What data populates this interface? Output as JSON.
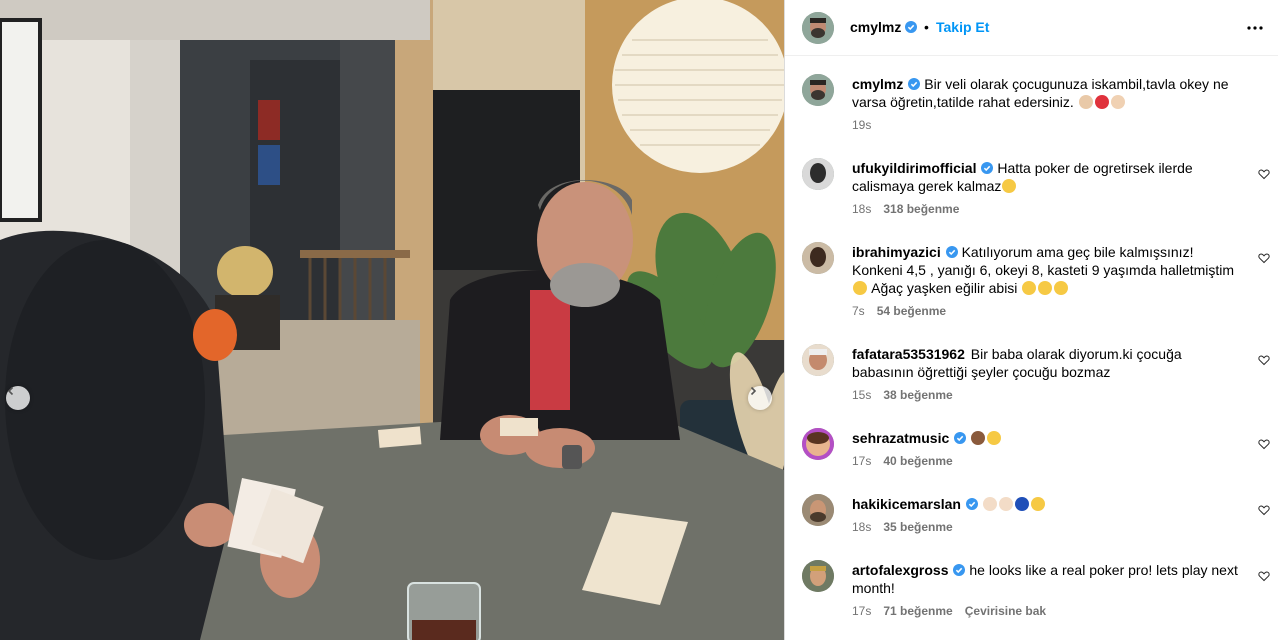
{
  "post": {
    "author": "cmylmz",
    "follow_label": "Takip Et",
    "separator": "•",
    "caption": "Bir veli olarak çocugunuza iskambil,tavla okey ne varsa öğretin,tatilde rahat edersiniz.",
    "caption_time": "19s"
  },
  "comments": [
    {
      "username": "ufukyildirimofficial",
      "verified": true,
      "text": "Hatta poker de ogretirsek ilerde calismaya gerek kalmaz",
      "time": "18s",
      "likes": "318 beğenme"
    },
    {
      "username": "ibrahimyazici",
      "verified": true,
      "text": "Katılıyorum ama geç bile kalmışsınız! Konkeni 4,5 , yanığı 6, okeyi 8, kasteti 9 yaşımda halletmiştim",
      "text2": "Ağaç yaşken eğilir abisi",
      "time": "7s",
      "likes": "54 beğenme"
    },
    {
      "username": "fafatara53531962",
      "verified": false,
      "text": "Bir baba olarak diyorum.ki çocuğa babasının öğrettiği şeyler çocuğu bozmaz",
      "time": "15s",
      "likes": "38 beğenme"
    },
    {
      "username": "sehrazatmusic",
      "verified": true,
      "text": "",
      "time": "17s",
      "likes": "40 beğenme"
    },
    {
      "username": "hakikicemarslan",
      "verified": true,
      "text": "",
      "time": "18s",
      "likes": "35 beğenme"
    },
    {
      "username": "artofalexgross",
      "verified": true,
      "text": "he looks like a real poker pro! lets play next month!",
      "time": "17s",
      "likes": "71 beğenme",
      "translate": "Çevirisine bak"
    }
  ],
  "colors": {
    "accent": "#0095f6",
    "verified": "#3897f0",
    "meta": "#737373"
  },
  "icons": [
    "chevron-left-icon",
    "chevron-right-icon",
    "more-icon",
    "heart-icon",
    "verified-icon"
  ]
}
